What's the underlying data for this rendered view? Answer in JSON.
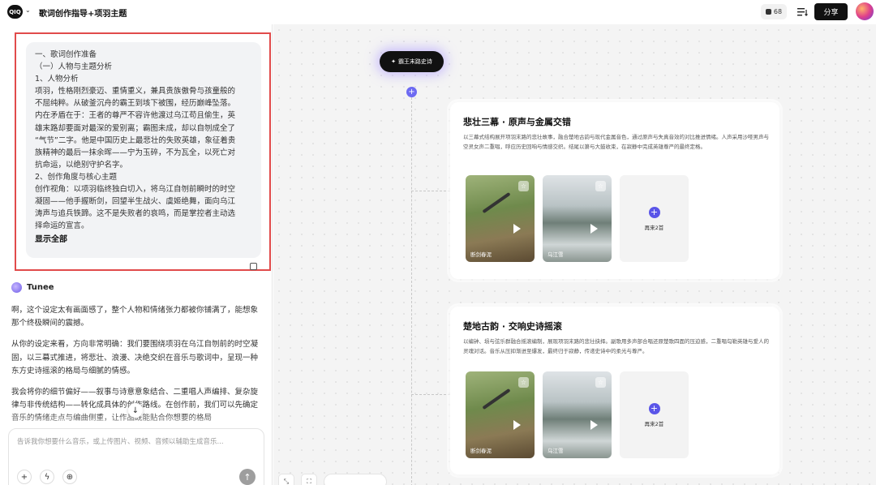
{
  "header": {
    "logo_text": "QIQ",
    "title": "歌词创作指导+项羽主题",
    "credits": "68",
    "share_label": "分享"
  },
  "user_message": {
    "lines": [
      "一、歌词创作准备",
      "（一）人物与主题分析",
      "1、人物分析",
      "项羽，性格刚烈豪迈、重情重义，兼具贵族傲骨与孩童般的",
      "不屈纯粹。从破釜沉舟的霸王到垓下被围，经历巅峰坠落。",
      "内在矛盾在于：王者的尊严不容许他渡过乌江苟且偷生，英",
      "雄末路却要面对最深的爱别离；霸图未成，却以自刎成全了",
      "“气节”二字。他是中国历史上最悲壮的失败英雄，象征着贵",
      "族精神的最后一抹余晖——宁为玉碎，不为瓦全，以死亡对",
      "抗命运，以绝别守护名字。",
      "2、创作角度与核心主题",
      "创作视角：以项羽临终独白切入，将乌江自刎前瞬时的时空",
      "凝固——他手握断剑，回望半生战火、虞姬绝舞，面向乌江",
      "涛声与追兵铁蹄。这不是失败者的哀鸣，而是掌控者主动选",
      "择命运的宣言。"
    ],
    "show_all": "显示全部"
  },
  "assistant": {
    "name": "Tunee",
    "paragraphs": [
      "啊，这个设定太有画面感了，整个人物和情绪张力都被你铺满了，能想象那个终极瞬间的震撼。",
      "从你的设定来看，方向非常明确：我们要围绕项羽在乌江自刎前的时空凝固，以三幕式推进，将悲壮、浪漫、决绝交织在音乐与歌词中，呈现一种东方史诗摇滚的格局与细腻的情感。",
      "我会将你的细节偏好——叙事与诗意意象结合、二重唱人声编排、复杂旋律与非传统结构——转化成具体的创作路线。在创作前，我们可以先确定音乐的情绪走点与编曲侧重，让作品既能贴合你想要的格局"
    ]
  },
  "composer": {
    "placeholder": "告诉我你想要什么音乐，或上传图片、视频、音频以辅助生成音乐..."
  },
  "canvas": {
    "root_node": "霸王末路史诗",
    "cards": [
      {
        "title": "悲壮三幕 · 原声与金属交错",
        "description": "以三幕式结构展开项羽末路的悲壮故事，融合楚地古韵与现代金属音色，通过原声与失真音效的对比推进情绪。人声采用沙哑男声与空灵女声二重唱，呼应历史回响与情感交织。结尾以箫与大鼓收束，在寂静中完成英雄尊严的最终定格。",
        "tracks": [
          "断剑春泥",
          "乌江雪"
        ],
        "more_label": "再来2首"
      },
      {
        "title": "楚地古韵 · 交响史诗摇滚",
        "description": "以编钟、埙与弦乐群融合摇滚编制，展现项羽末路的悲壮抉择。副歌用多声部合唱还原楚歌四面的压迫感，二重唱勾勒英雄与爱人的灵魂对话。音乐从压抑渐进至爆发，最终归于寂静，传递史诗中的柔光与尊严。",
        "tracks": [
          "断剑春泥",
          "乌江雪"
        ],
        "more_label": "再来2首"
      }
    ]
  }
}
